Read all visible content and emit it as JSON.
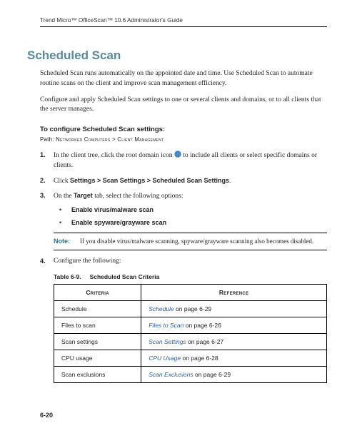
{
  "runningHeader": "Trend Micro™ OfficeScan™ 10.6 Administrator's Guide",
  "title": "Scheduled Scan",
  "para1": "Scheduled Scan runs automatically on the appointed date and time. Use Scheduled Scan to automate routine scans on the client and improve scan management efficiency.",
  "para2": "Configure and apply Scheduled Scan settings to one or several clients and domains, or to all clients that the server manages.",
  "subhead": "To configure Scheduled Scan settings:",
  "pathLabel": "Path: ",
  "pathValue": "Networked Computers > Client Management",
  "step1a": "In the client tree, click the root domain icon ",
  "step1b": " to include all clients or select specific domains or clients.",
  "step2a": "Click ",
  "step2Path": "Settings > Scan Settings > Scheduled Scan Settings",
  "step2b": ".",
  "step3a": "On the ",
  "step3Tab": "Target",
  "step3b": " tab, select the following options:",
  "bullet1": "Enable virus/malware scan",
  "bullet2": "Enable spyware/grayware scan",
  "noteLabel": "Note:",
  "noteText": "If you disable virus/malware scanning, spyware/grayware scanning also becomes disabled.",
  "step4": "Configure the following:",
  "tableNum": "Table 6-9.",
  "tableTitle": "Scheduled Scan Criteria",
  "th1": "Criteria",
  "th2": "Reference",
  "rows": [
    {
      "c": "Schedule",
      "link": "Schedule",
      "suf": " on page 6-29"
    },
    {
      "c": "Files to scan",
      "link": "Files to Scan",
      "suf": " on page 6-26"
    },
    {
      "c": "Scan settings",
      "link": "Scan Settings",
      "suf": " on page 6-27"
    },
    {
      "c": "CPU usage",
      "link": "CPU Usage",
      "suf": " on page 6-28"
    },
    {
      "c": "Scan exclusions",
      "link": "Scan Exclusions",
      "suf": " on page 6-29"
    }
  ],
  "pageNum": "6-20"
}
